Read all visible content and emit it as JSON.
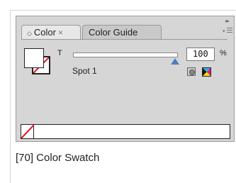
{
  "panel": {
    "tabs": [
      {
        "label": "Color",
        "active": true
      },
      {
        "label": "Color Guide",
        "active": false
      }
    ],
    "collapse_glyph": "▸▸",
    "close_glyph": "×",
    "dropdown_glyph": "◇",
    "tint": {
      "label": "T",
      "value": "100",
      "unit": "%",
      "fraction": 1.0
    },
    "swatch_name": "Spot 1",
    "icons": [
      "spot-color-icon",
      "process-color-icon",
      "panel-menu-icon",
      "none-swatch-icon"
    ],
    "colors": {
      "panel_bg": "#d6d6d6",
      "active_tab": "#e8e8e8",
      "inactive_tab": "#c9c9c9",
      "none_slash": "#e0102a",
      "slider_thumb": "#4a7fc0"
    }
  },
  "caption": "[70] Color Swatch"
}
